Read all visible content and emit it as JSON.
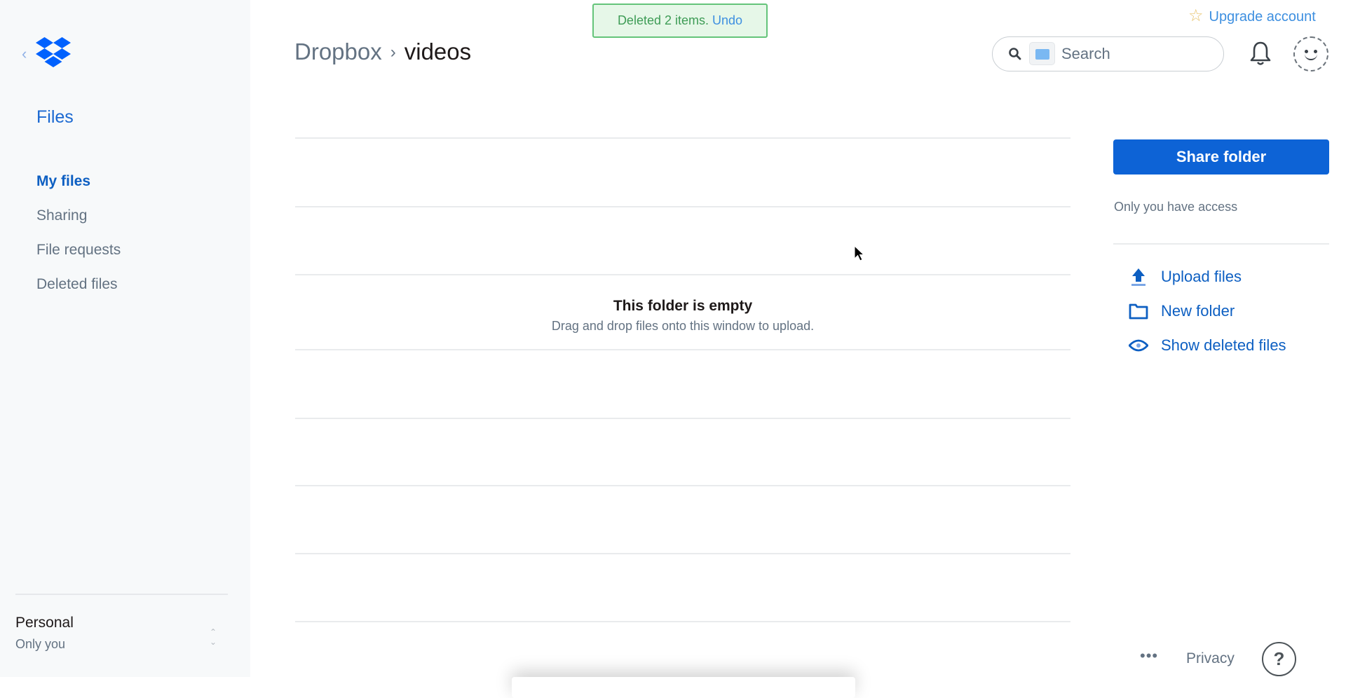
{
  "sidebar": {
    "back_icon": "chevron-left-icon",
    "logo_icon": "dropbox-logo-icon",
    "section_title": "Files",
    "items": [
      {
        "label": "My files",
        "active": true
      },
      {
        "label": "Sharing",
        "active": false
      },
      {
        "label": "File requests",
        "active": false
      },
      {
        "label": "Deleted files",
        "active": false
      }
    ],
    "account": {
      "name": "Personal",
      "subtitle": "Only you",
      "switcher_icon": "chevron-updown-icon"
    }
  },
  "toast": {
    "message": "Deleted 2 items.",
    "action": "Undo"
  },
  "breadcrumb": {
    "root": "Dropbox",
    "separator": "›",
    "current": "videos"
  },
  "header": {
    "upgrade_label": "Upgrade account",
    "upgrade_icon": "star-icon",
    "search_placeholder": "Search",
    "search_icon": "search-icon",
    "search_scope_icon": "folder-icon",
    "notifications_icon": "bell-icon",
    "avatar_icon": "avatar-face-icon"
  },
  "main": {
    "empty_title": "This folder is empty",
    "empty_subtitle": "Drag and drop files onto this window to upload."
  },
  "right_panel": {
    "share_button": "Share folder",
    "access_text": "Only you have access",
    "actions": [
      {
        "label": "Upload files",
        "icon": "upload-icon"
      },
      {
        "label": "New folder",
        "icon": "folder-icon"
      },
      {
        "label": "Show deleted files",
        "icon": "eye-icon"
      }
    ]
  },
  "footer": {
    "more_label": "•••",
    "privacy_label": "Privacy",
    "help_label": "?"
  },
  "colors": {
    "brand": "#0061fe",
    "primary_button": "#0d63d6",
    "link": "#0d5fc2",
    "toast_bg": "#e6f7e8",
    "toast_border": "#64c47a"
  }
}
